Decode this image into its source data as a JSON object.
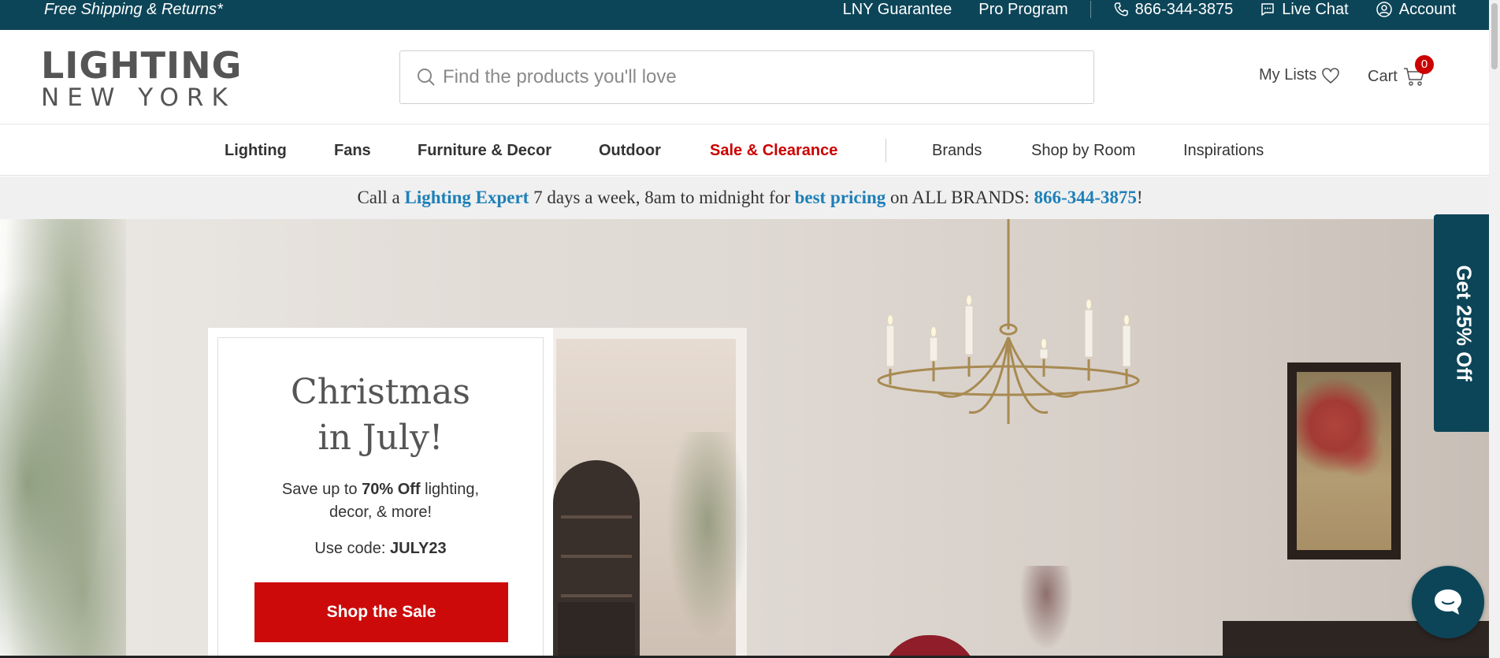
{
  "topbar": {
    "promo": "Free Shipping & Returns*",
    "guarantee": "LNY Guarantee",
    "pro": "Pro Program",
    "phone": "866-344-3875",
    "chat": "Live Chat",
    "account": "Account"
  },
  "logo": {
    "line1": "LIGHTING",
    "line2": "NEW YORK"
  },
  "search": {
    "placeholder": "Find the products you'll love"
  },
  "header": {
    "my_lists": "My Lists",
    "cart": "Cart",
    "cart_count": "0"
  },
  "nav": {
    "lighting": "Lighting",
    "fans": "Fans",
    "furniture": "Furniture & Decor",
    "outdoor": "Outdoor",
    "sale": "Sale & Clearance",
    "brands": "Brands",
    "room": "Shop by Room",
    "inspirations": "Inspirations"
  },
  "expert_bar": {
    "t1": "Call a ",
    "expert": "Lighting Expert",
    "t2": " 7 days a week, 8am to midnight for ",
    "pricing": "best pricing",
    "t3": " on ALL BRANDS: ",
    "phone": "866-344-3875",
    "t4": "!"
  },
  "promo_card": {
    "title1": "Christmas",
    "title2": "in July!",
    "desc1": "Save up to ",
    "desc_bold": "70% Off",
    "desc2": " lighting, decor, & more!",
    "code_label": "Use code: ",
    "code": "JULY23",
    "button": "Shop the Sale"
  },
  "side_tab": {
    "label": "Get 25% Off"
  },
  "colors": {
    "brand_teal": "#0d4558",
    "sale_red": "#cc0a0a",
    "link_blue": "#1e80b8"
  }
}
